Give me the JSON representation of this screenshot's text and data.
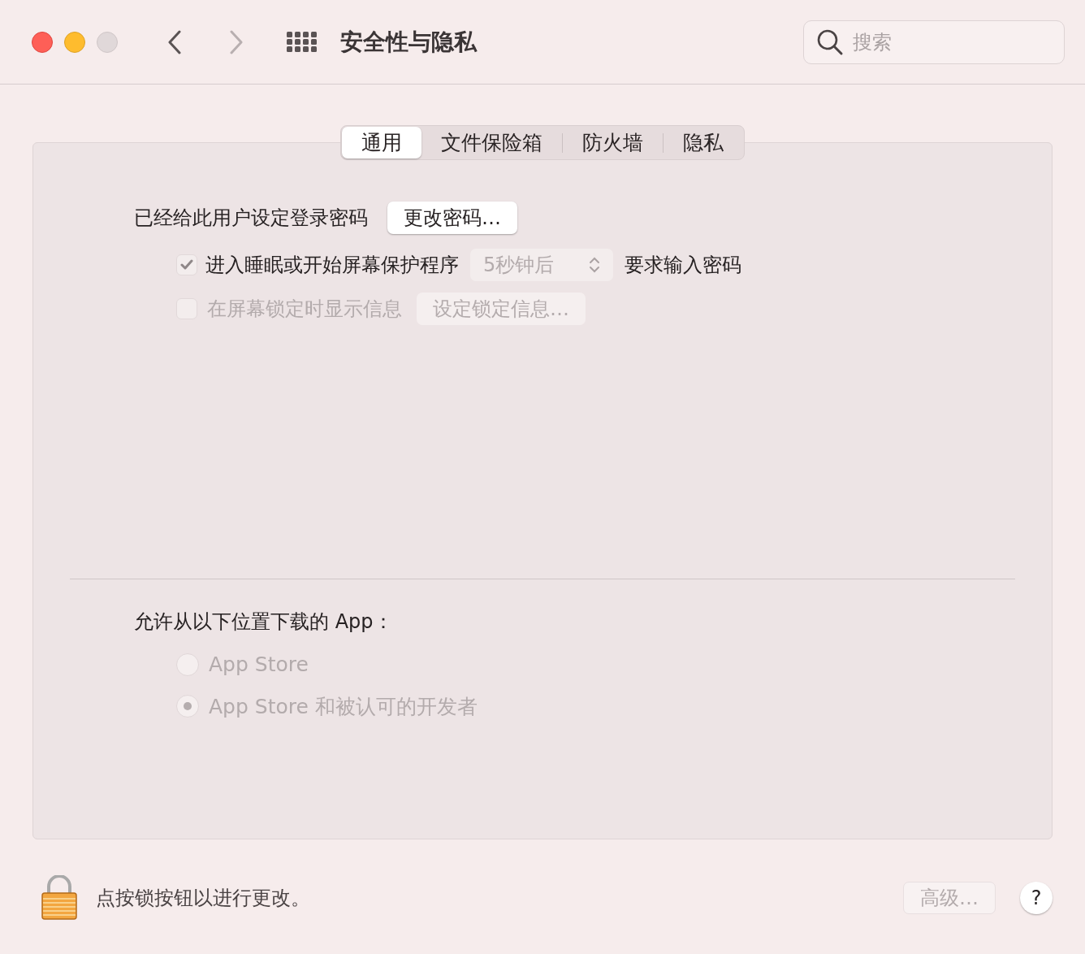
{
  "window": {
    "title": "安全性与隐私"
  },
  "search": {
    "placeholder": "搜索"
  },
  "tabs": [
    {
      "label": "通用",
      "selected": true
    },
    {
      "label": "文件保险箱",
      "selected": false
    },
    {
      "label": "防火墙",
      "selected": false
    },
    {
      "label": "隐私",
      "selected": false
    }
  ],
  "general": {
    "password_label": "已经给此用户设定登录密码",
    "change_password_button": "更改密码…",
    "require_password": {
      "label": "进入睡眠或开始屏幕保护程序",
      "checked": true,
      "disabled": true,
      "delay": {
        "value": "5秒钟后",
        "disabled": true
      },
      "suffix": "要求输入密码"
    },
    "lock_message": {
      "label": "在屏幕锁定时显示信息",
      "checked": false,
      "disabled": true,
      "button": {
        "label": "设定锁定信息…",
        "disabled": true
      }
    }
  },
  "downloads": {
    "label": "允许从以下位置下载的 App：",
    "options": [
      {
        "label": "App Store",
        "selected": false,
        "disabled": true
      },
      {
        "label": "App Store 和被认可的开发者",
        "selected": true,
        "disabled": true
      }
    ]
  },
  "footer": {
    "lock_text": "点按锁按钮以进行更改。",
    "advanced_button": {
      "label": "高级…",
      "disabled": true
    },
    "help_button": "?"
  }
}
